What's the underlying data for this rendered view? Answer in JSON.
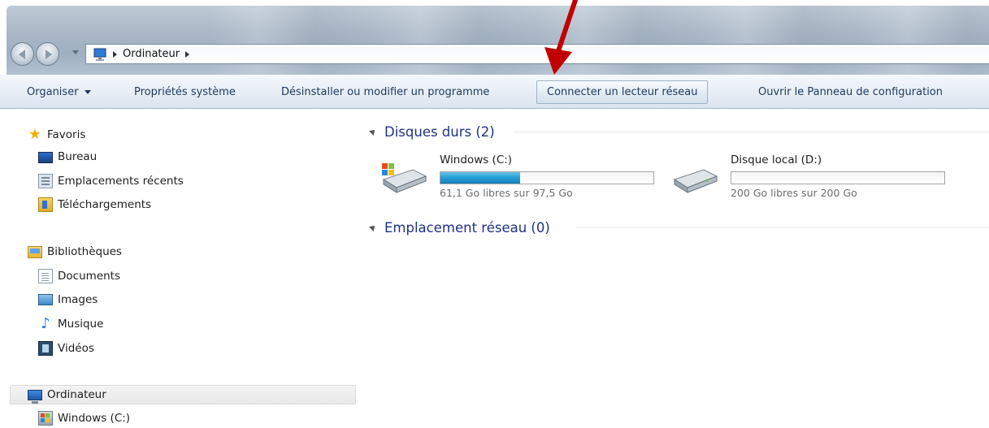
{
  "window": {
    "breadcrumb": [
      "Ordinateur"
    ]
  },
  "toolbar": {
    "items": [
      {
        "label": "Organiser",
        "has_dropdown": true
      },
      {
        "label": "Propriétés système"
      },
      {
        "label": "Désinstaller ou modifier un programme"
      },
      {
        "label": "Connecter un lecteur réseau",
        "highlighted": true
      },
      {
        "label": "Ouvrir le Panneau de configuration"
      }
    ]
  },
  "sidebar": {
    "favorites": {
      "header": "Favoris",
      "items": [
        {
          "label": "Bureau",
          "icon": "desktop-icon"
        },
        {
          "label": "Emplacements récents",
          "icon": "recent-places-icon"
        },
        {
          "label": "Téléchargements",
          "icon": "downloads-icon"
        }
      ]
    },
    "libraries": {
      "header": "Bibliothèques",
      "items": [
        {
          "label": "Documents",
          "icon": "documents-icon"
        },
        {
          "label": "Images",
          "icon": "images-icon"
        },
        {
          "label": "Musique",
          "icon": "music-icon"
        },
        {
          "label": "Vidéos",
          "icon": "videos-icon"
        }
      ]
    },
    "computer": {
      "header": "Ordinateur",
      "selected": true,
      "items": [
        {
          "label": "Windows (C:)",
          "icon": "windows-drive-icon"
        }
      ]
    }
  },
  "content": {
    "groups": [
      {
        "title": "Disques durs (2)",
        "drives": [
          {
            "name": "Windows (C:)",
            "free_text": "61,1 Go libres sur 97,5 Go",
            "used_fraction": 0.373
          },
          {
            "name": "Disque local (D:)",
            "free_text": "200 Go libres sur 200 Go",
            "used_fraction": 0.0
          }
        ]
      },
      {
        "title": "Emplacement réseau (0)",
        "drives": []
      }
    ]
  },
  "colors": {
    "accent_arrow": "#c00000",
    "group_title": "#1e3287",
    "drive_fill": "#26a0da"
  }
}
